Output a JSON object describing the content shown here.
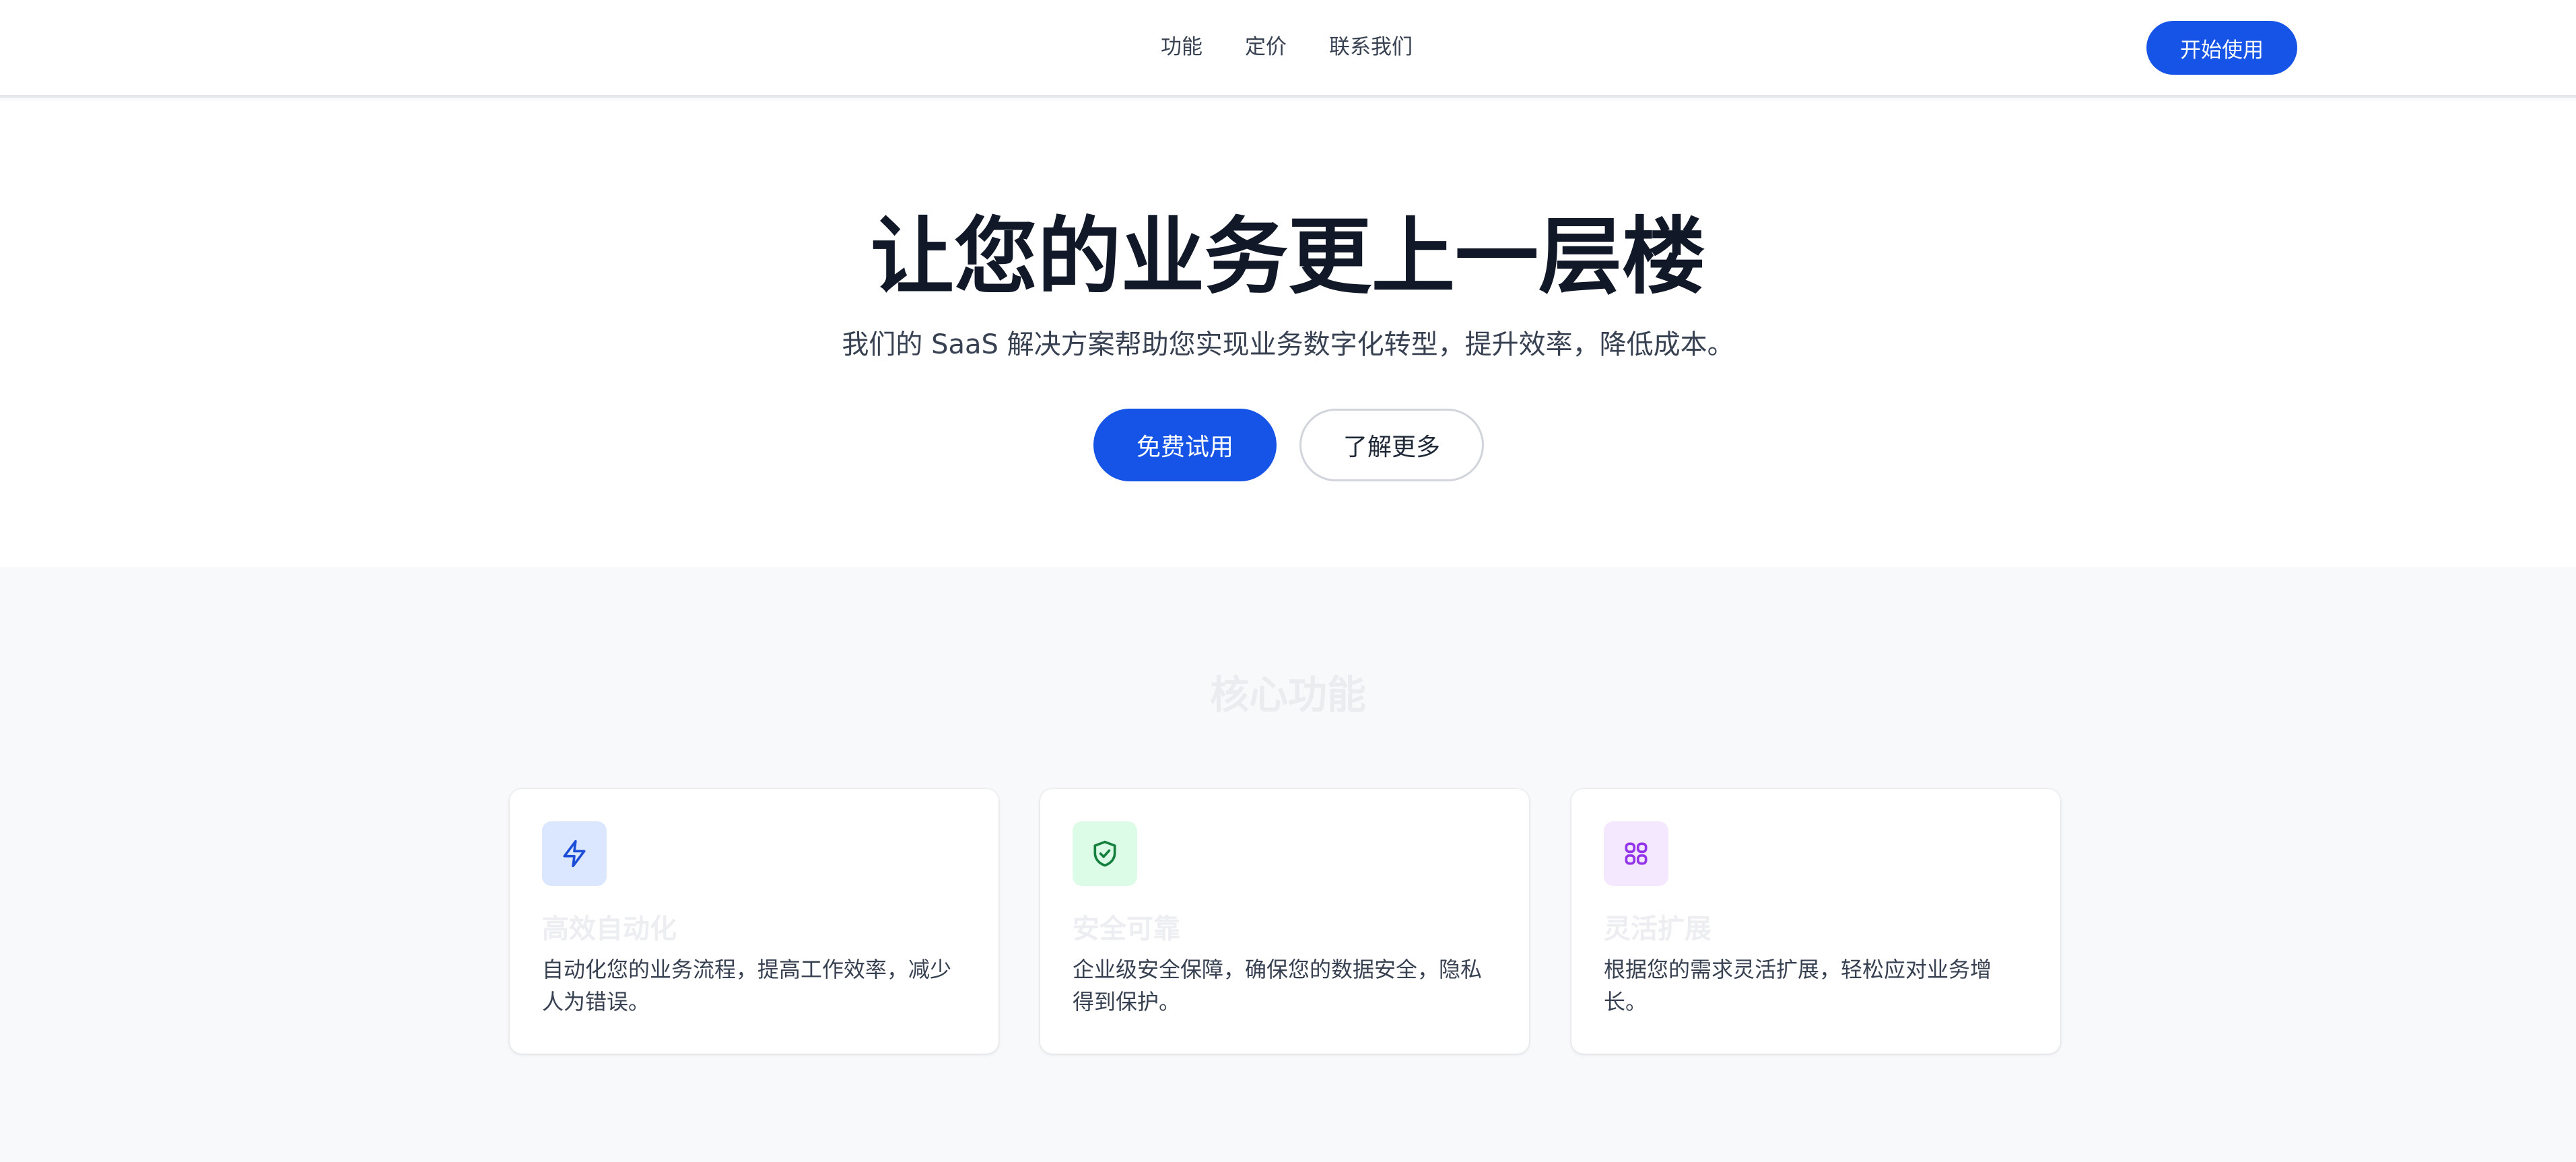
{
  "nav": {
    "links": [
      "功能",
      "定价",
      "联系我们"
    ],
    "cta_label": "开始使用"
  },
  "hero": {
    "title": "让您的业务更上一层楼",
    "subtitle": "我们的 SaaS 解决方案帮助您实现业务数字化转型，提升效率，降低成本。",
    "primary_button": "免费试用",
    "secondary_button": "了解更多"
  },
  "features": {
    "title": "核心功能",
    "cards": [
      {
        "icon": "lightning-icon",
        "icon_bg": "#dbe7fe",
        "icon_color": "#1d4ed8",
        "title": "高效自动化",
        "description": "自动化您的业务流程，提高工作效率，减少人为错误。"
      },
      {
        "icon": "shield-check-icon",
        "icon_bg": "#dcfce7",
        "icon_color": "#15803d",
        "title": "安全可靠",
        "description": "企业级安全保障，确保您的数据安全，隐私得到保护。"
      },
      {
        "icon": "grid-icon",
        "icon_bg": "#f3e8ff",
        "icon_color": "#9333ea",
        "title": "灵活扩展",
        "description": "根据您的需求灵活扩展，轻松应对业务增长。"
      }
    ]
  },
  "colors": {
    "accent": "#1554e6",
    "heading": "#111827",
    "body_text": "#374151",
    "section_bg": "#f8f9fb"
  }
}
